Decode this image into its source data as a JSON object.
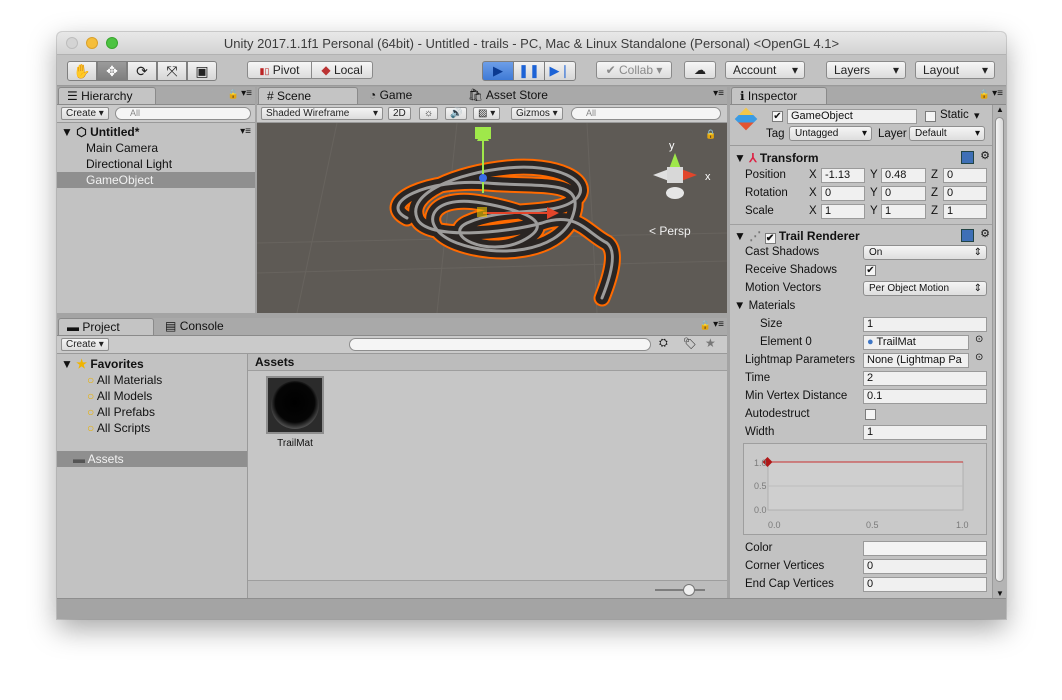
{
  "window": {
    "title": "Unity 2017.1.1f1 Personal (64bit) - Untitled - trails - PC, Mac & Linux Standalone (Personal) <OpenGL 4.1>"
  },
  "toolbar": {
    "pivot": "Pivot",
    "local": "Local",
    "collab": "Collab",
    "account": "Account",
    "layers": "Layers",
    "layout": "Layout"
  },
  "hierarchy": {
    "tab": "Hierarchy",
    "create": "Create",
    "search_placeholder": "All",
    "scene": "Untitled*",
    "items": [
      "Main Camera",
      "Directional Light",
      "GameObject"
    ]
  },
  "scene_view": {
    "tabs": [
      "Scene",
      "Game",
      "Asset Store"
    ],
    "shading": "Shaded Wireframe",
    "mode_2d": "2D",
    "gizmos": "Gizmos",
    "search_placeholder": "All",
    "axis_x": "x",
    "axis_y": "y",
    "persp": "Persp"
  },
  "project": {
    "tabs": [
      "Project",
      "Console"
    ],
    "create": "Create",
    "favorites": "Favorites",
    "favorite_items": [
      "All Materials",
      "All Models",
      "All Prefabs",
      "All Scripts"
    ],
    "assets_folder": "Assets",
    "assets_header": "Assets",
    "asset_items": [
      {
        "name": "TrailMat"
      }
    ]
  },
  "inspector": {
    "tab": "Inspector",
    "object_name": "GameObject",
    "static_label": "Static",
    "tag_label": "Tag",
    "tag_value": "Untagged",
    "layer_label": "Layer",
    "layer_value": "Default",
    "transform": {
      "title": "Transform",
      "position": {
        "label": "Position",
        "x": "-1.13",
        "y": "0.48",
        "z": "0"
      },
      "rotation": {
        "label": "Rotation",
        "x": "0",
        "y": "0",
        "z": "0"
      },
      "scale": {
        "label": "Scale",
        "x": "1",
        "y": "1",
        "z": "1"
      },
      "axis_labels": [
        "X",
        "Y",
        "Z"
      ]
    },
    "trail_renderer": {
      "title": "Trail Renderer",
      "cast_shadows": {
        "label": "Cast Shadows",
        "value": "On"
      },
      "receive_shadows": {
        "label": "Receive Shadows",
        "checked": true
      },
      "motion_vectors": {
        "label": "Motion Vectors",
        "value": "Per Object Motion"
      },
      "materials": {
        "label": "Materials",
        "size_label": "Size",
        "size": "1",
        "element_label": "Element 0",
        "element_value": "TrailMat"
      },
      "lightmap": {
        "label": "Lightmap Parameters",
        "value": "None (Lightmap Pa"
      },
      "time": {
        "label": "Time",
        "value": "2"
      },
      "min_vertex": {
        "label": "Min Vertex Distance",
        "value": "0.1"
      },
      "autodestruct": {
        "label": "Autodestruct",
        "checked": false
      },
      "width": {
        "label": "Width",
        "value": "1"
      },
      "curve": {
        "y_ticks": [
          "1.0",
          "0.5",
          "0.0"
        ],
        "x_ticks": [
          "0.0",
          "0.5",
          "1.0"
        ],
        "value": 1.0
      },
      "color_label": "Color",
      "corner_vertices": {
        "label": "Corner Vertices",
        "value": "0"
      },
      "end_cap_vertices": {
        "label": "End Cap Vertices",
        "value": "0"
      }
    }
  },
  "colors": {
    "accent": "#1d63d6",
    "selection": "#8f8f8f",
    "trail_outline": "#ff6a00",
    "panel": "#c2c2c2"
  }
}
